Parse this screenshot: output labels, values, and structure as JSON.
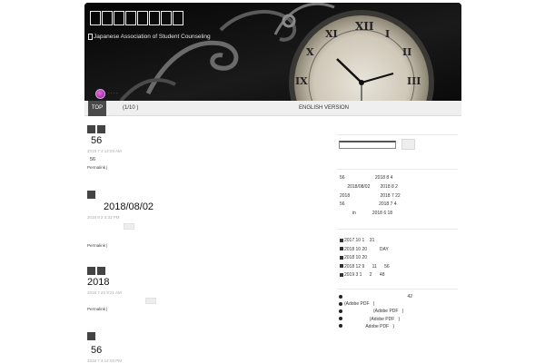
{
  "header": {
    "title_boxes": 8,
    "subtitle": "Japanese Association of Student Counseling",
    "logo_text": "· · · ·"
  },
  "nav": {
    "top": "TOP",
    "middle": "(1/10  )",
    "english": "ENGLISH VERSION"
  },
  "posts": [
    {
      "title": "56",
      "date": "2019 7 4   12:03 AM",
      "body": "56",
      "permalink": "Permalink |"
    },
    {
      "title": "2018/08/02",
      "date": "2018 8 2   3:33 PM",
      "body": "",
      "permalink": "Permalink |"
    },
    {
      "title": "2018",
      "date": "2018 7 22   9:21 AM",
      "body": "",
      "permalink": "Permalink |"
    },
    {
      "title": "56",
      "date": "2018 7 4   12:03 PM",
      "body": "",
      "permalink": ""
    }
  ],
  "sidebar": {
    "recent": [
      "56                        2018 8 4",
      "      2018/08/02        2018 8 2",
      "2018                        2018 7 22",
      "56                           2018 7 4",
      "          in             2018 6 18"
    ],
    "events": [
      "2017 10 1    31",
      "2018 10 20          DAY",
      "2018 10 20",
      "2018 12 9      11      56",
      "2019 3 1      2      48"
    ],
    "docs": [
      "                                                  42",
      "(Adobe PDF   )",
      "                       (Adobe PDF   )",
      "                    (Adobe PDF   )",
      "                 Adobe PDF   )"
    ]
  }
}
